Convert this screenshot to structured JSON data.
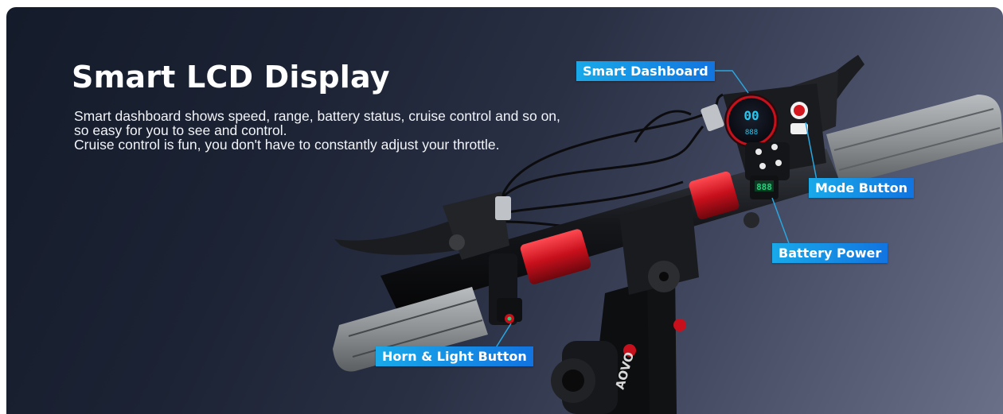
{
  "heading": {
    "title": "Smart LCD Display",
    "description_lines": [
      "Smart dashboard shows speed, range, battery status, cruise control and so on,",
      "so easy for you to see and control.",
      "Cruise control is fun, you don't have to constantly adjust your throttle."
    ]
  },
  "callouts": {
    "smart_dashboard": "Smart Dashboard",
    "mode_button": "Mode Button",
    "battery_power": "Battery Power",
    "horn_light_button": "Horn & Light Button"
  },
  "display": {
    "speed": "00",
    "battery_level": "888",
    "brand": "AOVO"
  },
  "colors": {
    "callout_start": "#19a9e9",
    "callout_end": "#1274e0",
    "accent_red": "#c8101c",
    "lcd_green": "#26d07c"
  },
  "icons": [
    "power-icon"
  ]
}
